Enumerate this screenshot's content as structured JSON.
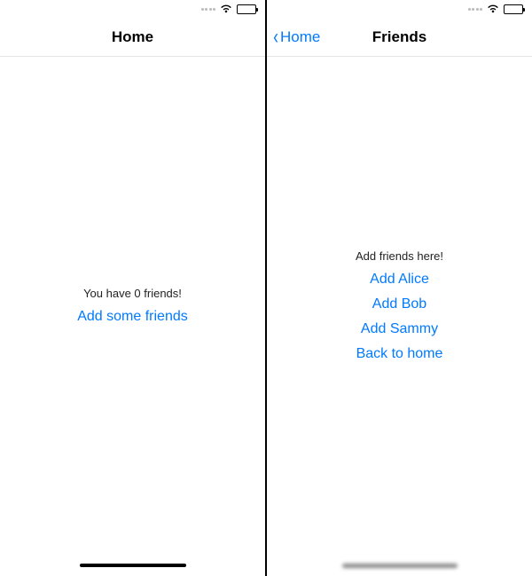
{
  "colors": {
    "accent": "#007AFF"
  },
  "left": {
    "nav": {
      "title": "Home"
    },
    "body": {
      "friend_count_text": "You have 0 friends!",
      "add_link": "Add some friends"
    }
  },
  "right": {
    "nav": {
      "back_label": "Home",
      "title": "Friends"
    },
    "body": {
      "heading": "Add friends here!",
      "actions": {
        "add_alice": "Add Alice",
        "add_bob": "Add Bob",
        "add_sammy": "Add Sammy",
        "back_home": "Back to home"
      }
    }
  }
}
